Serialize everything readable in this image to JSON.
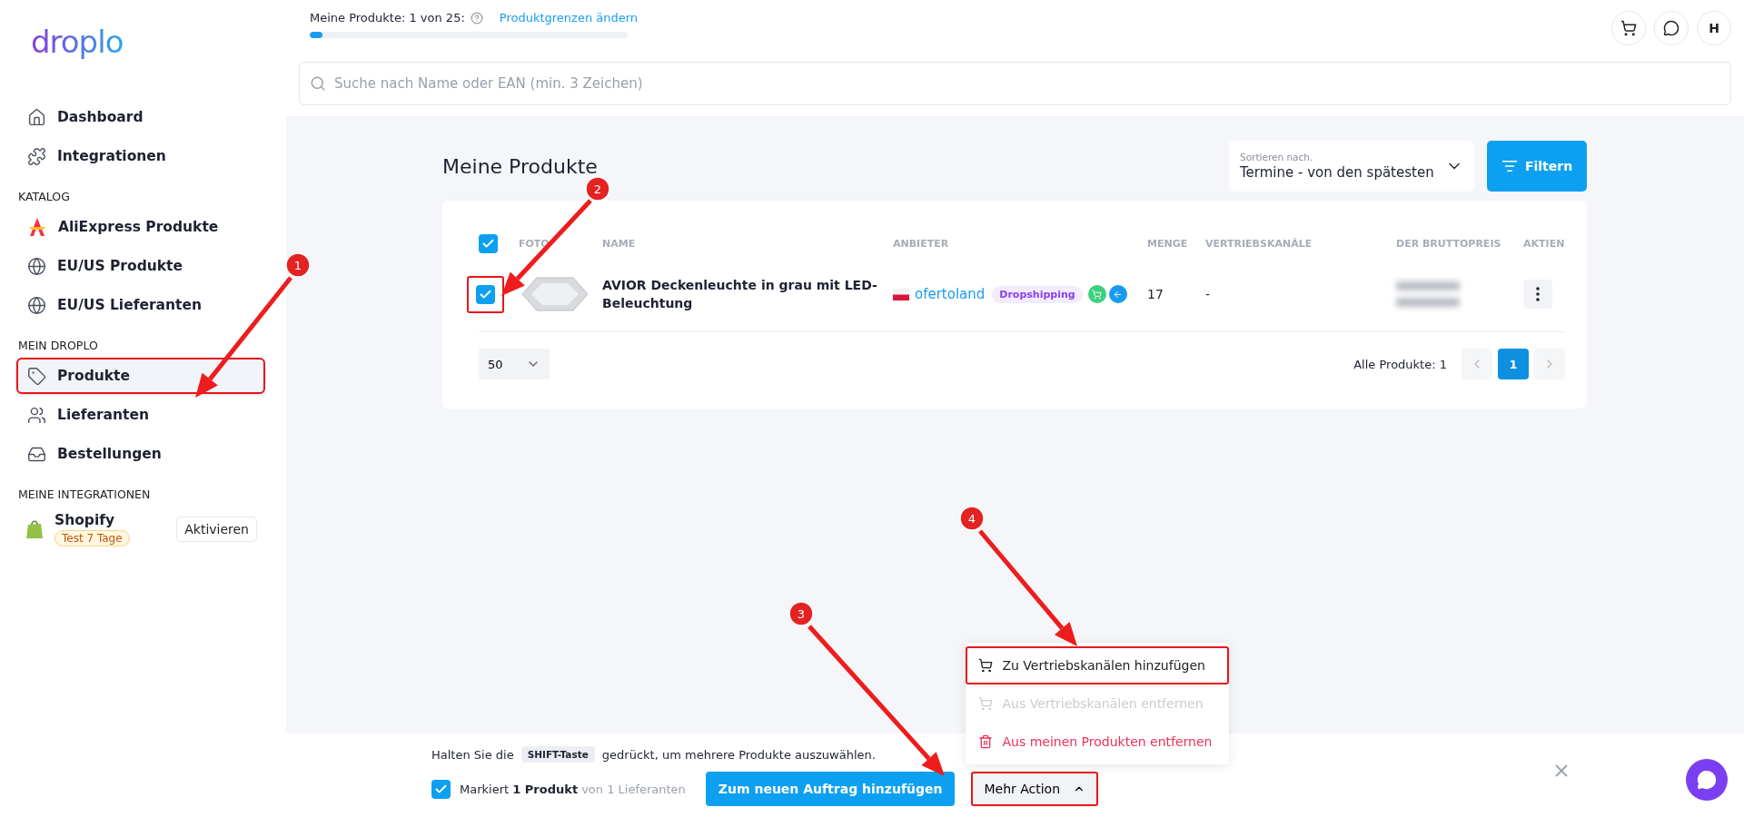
{
  "header": {
    "usage_label": "Meine Produkte: 1 von 25:",
    "limit_link": "Produktgrenzen ändern",
    "usage": {
      "level": 0.04
    },
    "avatar": "H"
  },
  "search": {
    "placeholder": "Suche nach Name oder EAN (min. 3 Zeichen)"
  },
  "sidebar": {
    "logo": "droplo",
    "sections": [
      {
        "items": [
          {
            "label": "Dashboard",
            "selected": false,
            "highlighted": false
          },
          {
            "label": "Integrationen",
            "selected": false,
            "highlighted": false
          }
        ]
      },
      {
        "heading": "KATALOG",
        "items": [
          {
            "label": "AliExpress Produkte",
            "selected": false,
            "highlighted": false
          },
          {
            "label": "EU/US Produkte",
            "selected": false,
            "highlighted": false
          },
          {
            "label": "EU/US Lieferanten",
            "selected": false,
            "highlighted": false
          }
        ]
      },
      {
        "heading": "MEIN DROPLO",
        "items": [
          {
            "label": "Produkte",
            "selected": true,
            "highlighted": true
          },
          {
            "label": "Lieferanten",
            "selected": false,
            "highlighted": false
          },
          {
            "label": "Bestellungen",
            "selected": false,
            "highlighted": false
          }
        ]
      }
    ],
    "integrations_heading": "MEINE INTEGRATIONEN",
    "integration": {
      "name": "Shopify",
      "badge": "Test 7 Tage",
      "button": "Aktivieren"
    }
  },
  "page_title": "Meine Produkte",
  "sort": {
    "label": "Sortieren nach.",
    "value": "Termine - von den spätesten"
  },
  "filter_button": "Filtern",
  "table": {
    "all_checked": true,
    "columns": [
      "FOTO",
      "NAME",
      "ANBIETER",
      "MENGE",
      "VERTRIEBSKANÄLE",
      "DER BRUTTOPREIS",
      "AKTIEN"
    ],
    "rows": [
      {
        "checked": true,
        "highlighted": true,
        "name": "AVIOR Deckenleuchte in grau mit LED-Beleuchtung",
        "supplier": "ofertoland",
        "tag": "Dropshipping",
        "quantity": "17",
        "channels": "-"
      }
    ]
  },
  "pagination": {
    "page_size": "50",
    "total": "Alle Produkte: 1",
    "pages": [
      {
        "label": "1",
        "selected": true
      }
    ]
  },
  "bottom_bar": {
    "hint_before": "Halten Sie die",
    "hint_key": "SHIFT-Taste",
    "hint_after": "gedrückt, um mehrere Produkte auszuwählen.",
    "select_all_checked": true,
    "selected_text": "Markiert **1 Produkt**",
    "supplier_text": "von 1 Lieferanten",
    "primary_button": "Zum neuen Auftrag hinzufügen",
    "more_button": {
      "label": "Mehr Action",
      "expanded": true,
      "highlighted": true
    }
  },
  "menu": [
    {
      "label": "Zu Vertriebskanälen hinzufügen",
      "kind": "add",
      "disabled": false,
      "highlighted": true
    },
    {
      "label": "Aus Vertriebskanälen entfernen",
      "kind": "remove",
      "disabled": true,
      "highlighted": false
    },
    {
      "label": "Aus meinen Produkten entfernen",
      "kind": "delete",
      "disabled": false,
      "highlighted": false
    }
  ],
  "annotations": [
    "1",
    "2",
    "3",
    "4"
  ]
}
